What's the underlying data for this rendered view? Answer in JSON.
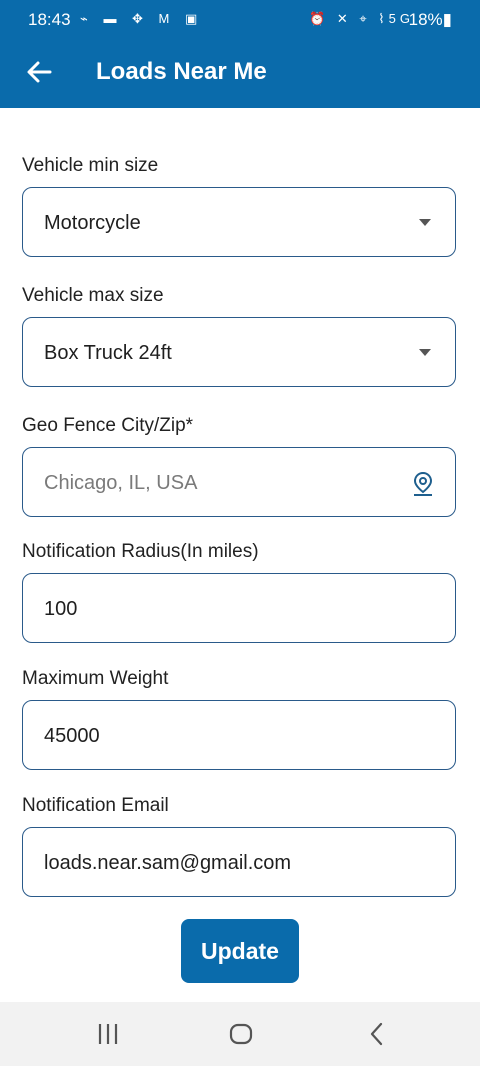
{
  "status": {
    "time": "18:43",
    "left_icons": "⌁ ▬ ✥ M ▣",
    "right_icons": "⏰ ✕ ⌖ ⌇5G",
    "battery": "18%"
  },
  "appbar": {
    "title": "Loads Near Me",
    "back_icon": "arrow-back-icon"
  },
  "form": {
    "min_size": {
      "label": "Vehicle min size",
      "value": "Motorcycle"
    },
    "max_size": {
      "label": "Vehicle max size",
      "value": "Box Truck 24ft"
    },
    "geo_fence": {
      "label": "Geo Fence City/Zip*",
      "placeholder": "Chicago, IL, USA",
      "icon": "location-pin-icon"
    },
    "radius": {
      "label": "Notification Radius(In miles)",
      "value": "100"
    },
    "weight": {
      "label": "Maximum Weight",
      "value": "45000"
    },
    "email": {
      "label": "Notification Email",
      "value": "loads.near.sam@gmail.com"
    }
  },
  "update_label": "Update",
  "colors": {
    "primary": "#0a6bab",
    "field_border": "#2a5a8a",
    "nav_bg": "#f2f2f2"
  },
  "navbar": {
    "recent_icon": "recent-apps-icon",
    "home_icon": "home-icon",
    "back_icon": "nav-back-icon"
  }
}
